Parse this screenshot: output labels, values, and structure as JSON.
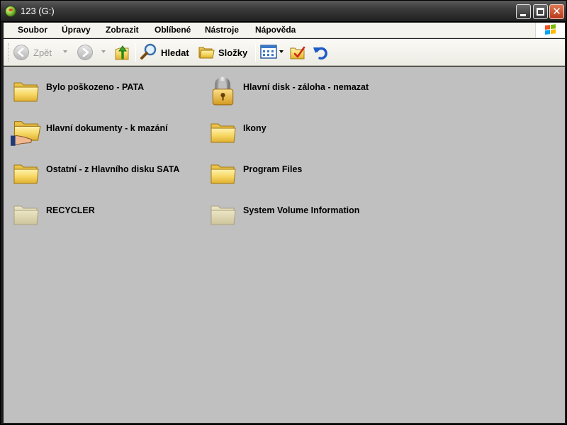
{
  "window": {
    "title": "123 (G:)",
    "icon": "drive-icon"
  },
  "menu": {
    "items": [
      "Soubor",
      "Úpravy",
      "Zobrazit",
      "Oblíbené",
      "Nástroje",
      "Nápověda"
    ]
  },
  "toolbar": {
    "back_label": "Zpět",
    "search_label": "Hledat",
    "folders_label": "Složky"
  },
  "files": [
    {
      "name": "Bylo poškozeno - PATA",
      "icon": "folder-icon"
    },
    {
      "name": "Hlavní disk - záloha - nemazat",
      "icon": "padlock-icon"
    },
    {
      "name": "Hlavní dokumenty - k mazání",
      "icon": "shared-folder-icon"
    },
    {
      "name": "Ikony",
      "icon": "folder-icon"
    },
    {
      "name": "Ostatní - z Hlavního disku SATA",
      "icon": "folder-icon"
    },
    {
      "name": "Program Files",
      "icon": "folder-icon"
    },
    {
      "name": "RECYCLER",
      "icon": "hidden-folder-icon"
    },
    {
      "name": "System Volume Information",
      "icon": "hidden-folder-icon"
    }
  ],
  "colors": {
    "content_background": "#c0c0c0",
    "folder_yellow": "#f5d768",
    "titlebar": "#2e2e2e"
  }
}
